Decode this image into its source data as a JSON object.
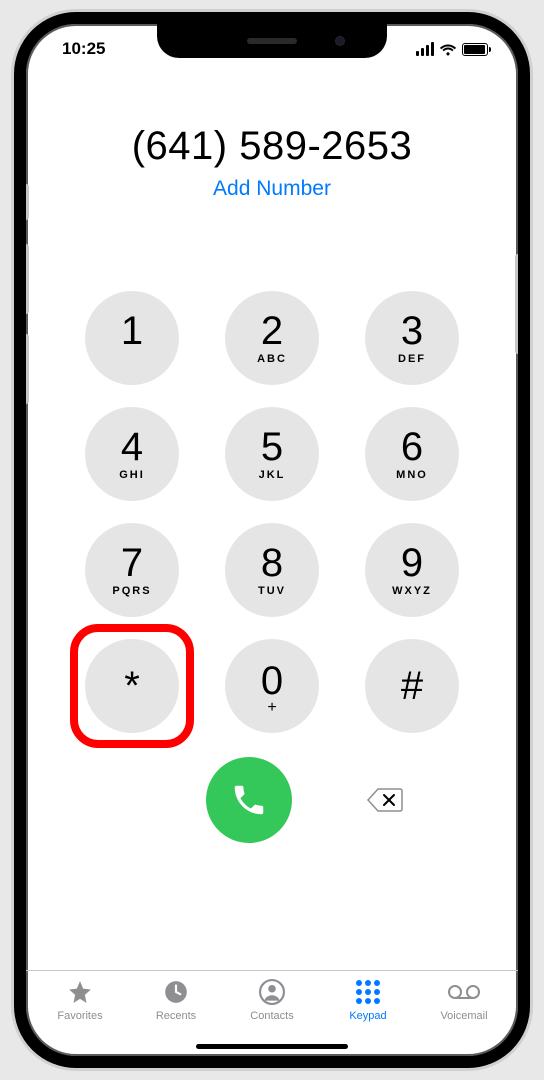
{
  "status": {
    "time": "10:25"
  },
  "dialer": {
    "number": "(641) 589-2653",
    "add_number_label": "Add Number"
  },
  "keys": [
    {
      "digit": "1",
      "letters": ""
    },
    {
      "digit": "2",
      "letters": "ABC"
    },
    {
      "digit": "3",
      "letters": "DEF"
    },
    {
      "digit": "4",
      "letters": "GHI"
    },
    {
      "digit": "5",
      "letters": "JKL"
    },
    {
      "digit": "6",
      "letters": "MNO"
    },
    {
      "digit": "7",
      "letters": "PQRS"
    },
    {
      "digit": "8",
      "letters": "TUV"
    },
    {
      "digit": "9",
      "letters": "WXYZ"
    },
    {
      "digit": "*",
      "letters": ""
    },
    {
      "digit": "0",
      "letters": "+"
    },
    {
      "digit": "#",
      "letters": ""
    }
  ],
  "highlighted_key": "*",
  "tabs": {
    "favorites": "Favorites",
    "recents": "Recents",
    "contacts": "Contacts",
    "keypad": "Keypad",
    "voicemail": "Voicemail",
    "active": "keypad"
  },
  "colors": {
    "accent": "#007aff",
    "call_green": "#34c759",
    "key_bg": "#e5e5e5",
    "inactive": "#8e8e93",
    "highlight": "#ff0000"
  }
}
